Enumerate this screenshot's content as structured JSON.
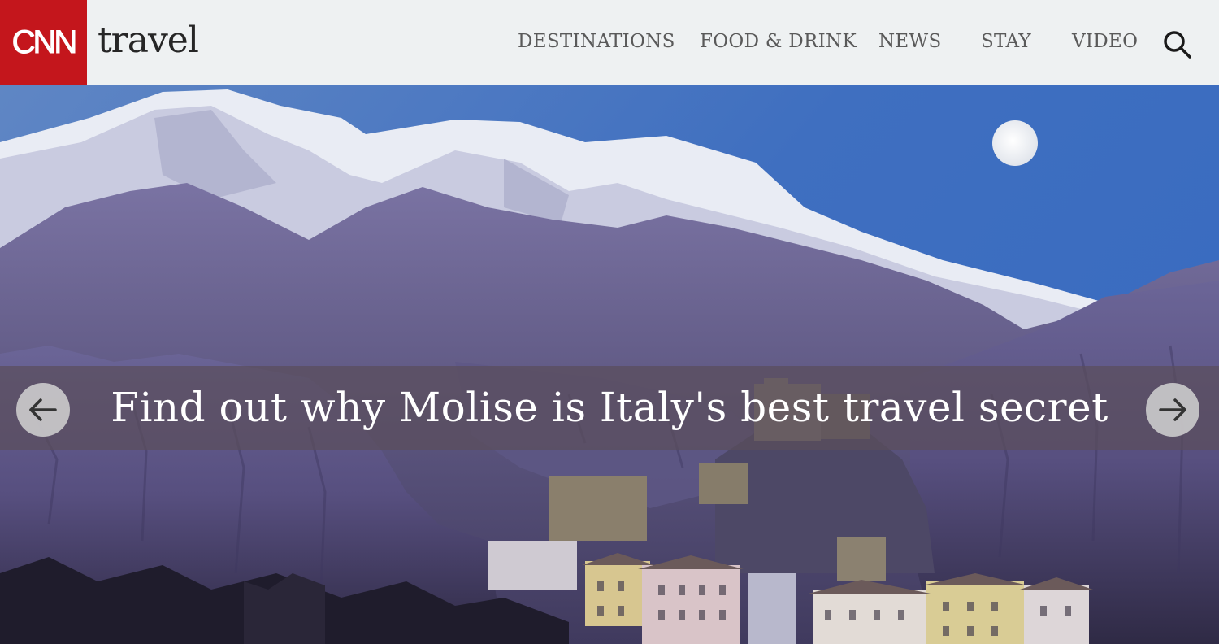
{
  "header": {
    "logo_text": "CNN",
    "brand": "travel",
    "nav": [
      {
        "id": "destinations",
        "label": "DESTINATIONS"
      },
      {
        "id": "food-drink",
        "label": "FOOD & DRINK"
      },
      {
        "id": "news",
        "label": "NEWS"
      },
      {
        "id": "stay",
        "label": "STAY"
      },
      {
        "id": "video",
        "label": "VIDEO"
      }
    ],
    "search_icon": "search-icon"
  },
  "hero": {
    "headline": "Find out why Molise is Italy's  best  travel  secret",
    "prev_icon": "arrow-left-icon",
    "next_icon": "arrow-right-icon"
  },
  "colors": {
    "brand_red": "#c4161c",
    "header_bg": "#eef1f2",
    "nav_text": "#5a5a5a",
    "caption_band": "#5a4e5c"
  }
}
